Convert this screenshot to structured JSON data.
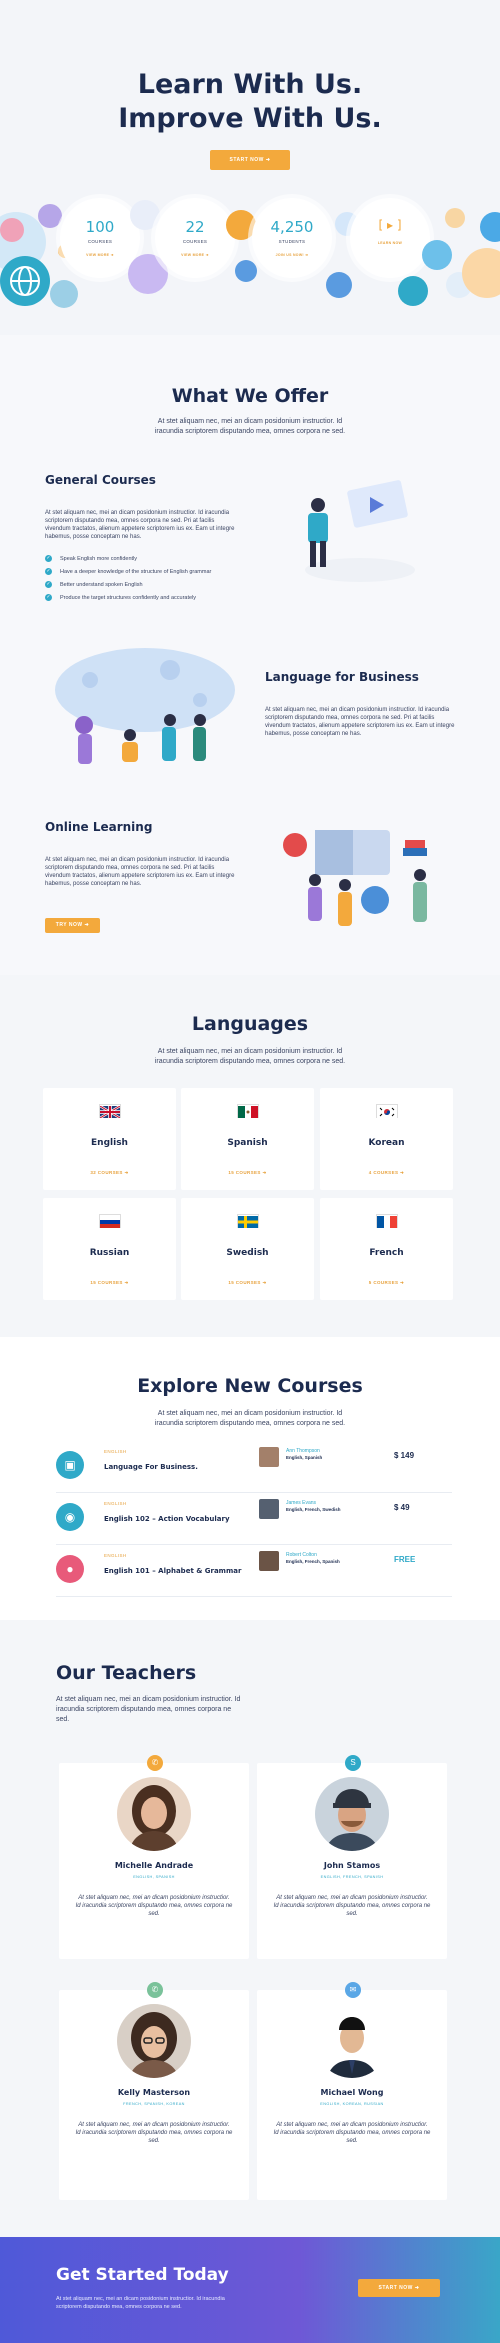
{
  "hero": {
    "title_line1": "Learn With Us.",
    "title_line2": "Improve With Us.",
    "cta_label": "START NOW",
    "stats": [
      {
        "value": "100",
        "label": "COURSES",
        "link": "VIEW MORE"
      },
      {
        "value": "22",
        "label": "COURSES",
        "link": "VIEW MORE"
      },
      {
        "value": "4,250",
        "label": "STUDENTS",
        "link": "JOIN US NOW!"
      },
      {
        "value": "",
        "label": "",
        "link": "LEARN NOW"
      }
    ]
  },
  "offer": {
    "title": "What We Offer",
    "subtitle_line1": "At stet aliquam nec, mei an dicam posidonium instructior. Id",
    "subtitle_line2": "iracundia scriptorem disputando mea, omnes corpora ne sed.",
    "features": [
      {
        "title": "General Courses",
        "text": "At stet aliquam nec, mei an dicam posidonium instructior. Id iracundia scriptorem disputando mea, omnes corpora ne sed. Pri at facilis vivendum tractatos, alienum appetere scriptorem ius ex. Eam ut integre habemus, posse conceptam ne has.",
        "checklist": [
          "Speak English more confidently",
          "Have a deeper knowledge of the structure of English grammar",
          "Better understand spoken English",
          "Produce the target structures confidently and accurately"
        ]
      },
      {
        "title": "Language for Business",
        "text": "At stet aliquam nec, mei an dicam posidonium instructior. Id iracundia scriptorem disputando mea, omnes corpora ne sed. Pri at facilis vivendum tractatos, alienum appetere scriptorem ius ex. Eam ut integre habemus, posse conceptam ne has."
      },
      {
        "title": "Online Learning",
        "text": "At stet aliquam nec, mei an dicam posidonium instructior. Id iracundia scriptorem disputando mea, omnes corpora ne sed. Pri at facilis vivendum tractatos, alienum appetere scriptorem ius ex. Eam ut integre habemus, posse conceptam ne has.",
        "cta_label": "TRY NOW"
      }
    ]
  },
  "languages": {
    "title": "Languages",
    "subtitle_line1": "At stet aliquam nec, mei an dicam posidonium instructior. Id",
    "subtitle_line2": "iracundia scriptorem disputando mea, omnes corpora ne sed.",
    "items": [
      {
        "name": "English",
        "link": "32 COURSES"
      },
      {
        "name": "Spanish",
        "link": "15 COURSES"
      },
      {
        "name": "Korean",
        "link": "4 COURSES"
      },
      {
        "name": "Russian",
        "link": "15 COURSES"
      },
      {
        "name": "Swedish",
        "link": "15 COURSES"
      },
      {
        "name": "French",
        "link": "5 COURSES"
      }
    ]
  },
  "courses": {
    "title": "Explore New Courses",
    "subtitle_line1": "At stet aliquam nec, mei an dicam posidonium instructior. Id",
    "subtitle_line2": "iracundia scriptorem disputando mea, omnes corpora ne sed.",
    "rows": [
      {
        "category": "ENGLISH",
        "name": "Language For Business.",
        "teacher": "Ann Thompson",
        "langs": "English, Spanish",
        "price": "$ 149"
      },
      {
        "category": "ENGLISH",
        "name": "English 102 – Action Vocabulary",
        "teacher": "James Evans",
        "langs": "English, French, Swedish",
        "price": "$ 49"
      },
      {
        "category": "ENGLISH",
        "name": "English 101 – Alphabet & Grammar",
        "teacher": "Robert Colton",
        "langs": "English, French, Spanish",
        "price": "FREE"
      }
    ]
  },
  "teachers": {
    "title": "Our Teachers",
    "intro": "At stet aliquam nec, mei an dicam posidonium instructior. Id iracundia scriptorem disputando mea, omnes corpora ne sed.",
    "people": [
      {
        "name": "Michelle Andrade",
        "langs": "ENGLISH, SPANISH",
        "desc": "At stet aliquam nec, mei an dicam posidonium instructior. Id iracundia scriptorem disputando mea, omnes corpora ne sed."
      },
      {
        "name": "John Stamos",
        "langs": "ENGLISH, FRENCH, SPANISH",
        "desc": "At stet aliquam nec, mei an dicam posidonium instructior. Id iracundia scriptorem disputando mea, omnes corpora ne sed."
      },
      {
        "name": "Kelly Masterson",
        "langs": "FRENCH, SPANISH, KOREAN",
        "desc": "At stet aliquam nec, mei an dicam posidonium instructior. Id iracundia scriptorem disputando mea, omnes corpora ne sed."
      },
      {
        "name": "Michael Wong",
        "langs": "ENGLISH, KOREAN, RUSSIAN",
        "desc": "At stet aliquam nec, mei an dicam posidonium instructior. Id iracundia scriptorem disputando mea, omnes corpora ne sed."
      }
    ]
  },
  "cta": {
    "title": "Get Started Today",
    "text": "At stet aliquam nec, mei an dicam posidonium instructior. Id iracundia scriptorem disputando mea, omnes corpora ne sed.",
    "button": "START NOW"
  },
  "colors": {
    "accent": "#f3a93c",
    "teal": "#2fa9c8",
    "navy": "#1c2b4f"
  }
}
